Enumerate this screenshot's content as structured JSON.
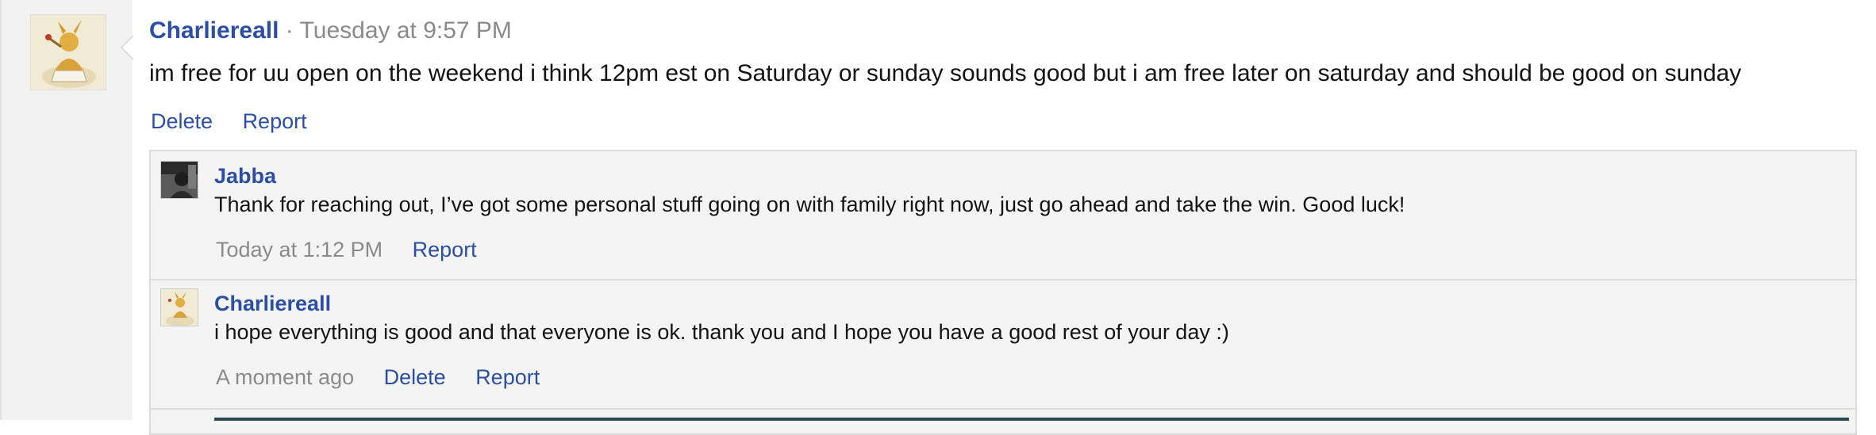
{
  "post": {
    "author": "Charliereall",
    "separator": "·",
    "timestamp": "Tuesday at 9:57 PM",
    "message": "im free for uu open on the weekend i think 12pm est on Saturday or sunday sounds good but i am free later on saturday and should be good on sunday",
    "actions": {
      "delete": "Delete",
      "report": "Report"
    }
  },
  "replies": [
    {
      "author": "Jabba",
      "message": "Thank for reaching out, I’ve got some personal stuff going on with family right now, just go ahead and take the win. Good luck!",
      "timestamp": "Today at 1:12 PM",
      "actions": {
        "report": "Report"
      }
    },
    {
      "author": "Charliereall",
      "message": "i hope everything is good and that everyone is ok. thank you and I hope you have a good rest of your day :)",
      "timestamp": "A moment ago",
      "actions": {
        "delete": "Delete",
        "report": "Report"
      }
    }
  ],
  "colors": {
    "link": "#2d4fa3",
    "muted": "#8a8a8a",
    "panel": "#f4f4f4"
  }
}
